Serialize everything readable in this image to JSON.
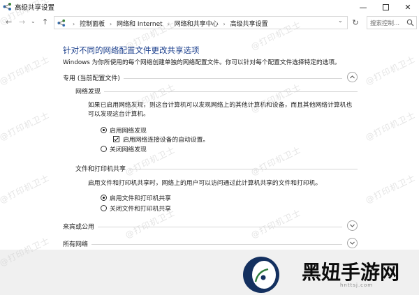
{
  "window": {
    "title": "高级共享设置",
    "minimize": "—",
    "close": "✕"
  },
  "nav": {
    "back": "←",
    "forward": "→",
    "recent": "⌄",
    "up": "↑",
    "dropdown": "⌄",
    "refresh": "↻"
  },
  "address": {
    "breadcrumbs": [
      "控制面板",
      "网络和 Internet",
      "网络和共享中心",
      "高级共享设置"
    ],
    "separator": "›"
  },
  "search": {
    "placeholder": "搜索控制..."
  },
  "main": {
    "heading": "针对不同的网络配置文件更改共享选项",
    "description": "Windows 为你所使用的每个网络创建单独的网络配置文件。你可以针对每个配置文件选择特定的选项。"
  },
  "sections": {
    "private": {
      "label": "专用 (当前配置文件)",
      "state": "expanded"
    },
    "guest": {
      "label": "来宾或公用",
      "state": "collapsed"
    },
    "all": {
      "label": "所有网络",
      "state": "collapsed"
    }
  },
  "network_discovery": {
    "title": "网络发现",
    "text_line1": "如果已启用网络发现，则这台计算机可以发现网络上的其他计算机和设备，而且其他网络计算机也",
    "text_line2": "可以发现这台计算机。",
    "option_on": "启用网络发现",
    "auto_setup": "启用网络连接设备的自动设置。",
    "option_off": "关闭网络发现",
    "selected": "on",
    "auto_setup_checked": true
  },
  "file_sharing": {
    "title": "文件和打印机共享",
    "text": "启用文件和打印机共享时，网络上的用户可以访问通过此计算机共享的文件和打印机。",
    "option_on": "启用文件和打印机共享",
    "option_off": "关闭文件和打印机共享",
    "selected": "on"
  },
  "watermark": {
    "text": "@打印机卫士"
  },
  "overlay_logo": {
    "text": "黑妞手游网",
    "url": "hnttsj.com"
  },
  "icons": {
    "app": "network-sharing-icon",
    "chevron_up": "chevron-up-icon",
    "chevron_down": "chevron-down-icon",
    "search": "search-icon"
  }
}
